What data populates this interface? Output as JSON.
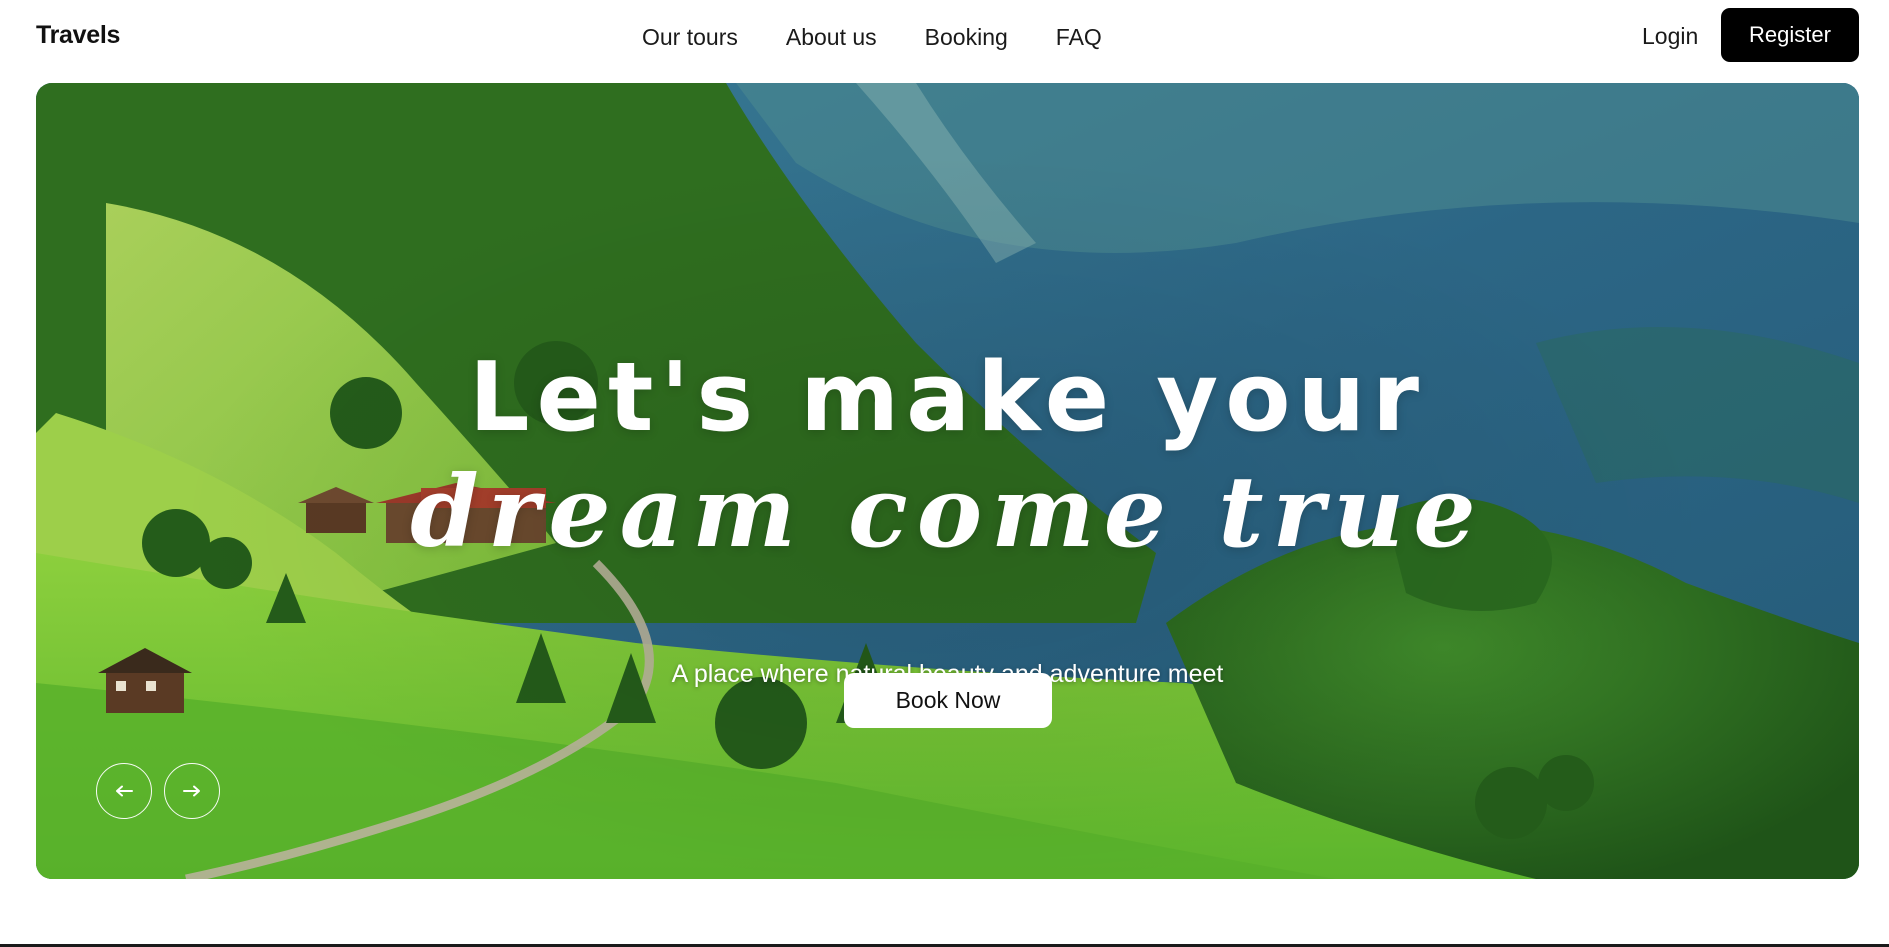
{
  "header": {
    "brand": "Travels",
    "nav": [
      {
        "label": "Our tours"
      },
      {
        "label": "About us"
      },
      {
        "label": "Booking"
      },
      {
        "label": "FAQ"
      }
    ],
    "login_label": "Login",
    "register_label": "Register"
  },
  "hero": {
    "title_line1": "Let's make your",
    "title_line2": "dream come true",
    "subtitle": "A place where natural beauty and adventure meet",
    "cta_label": "Book Now",
    "prev_icon": "arrow-left-icon",
    "next_icon": "arrow-right-icon"
  },
  "colors": {
    "primary_button_bg": "#000000",
    "hero_text": "#ffffff",
    "sky_lake": "#2e6b8a",
    "meadow": "#6cc23a",
    "forest": "#2f6e1f"
  }
}
